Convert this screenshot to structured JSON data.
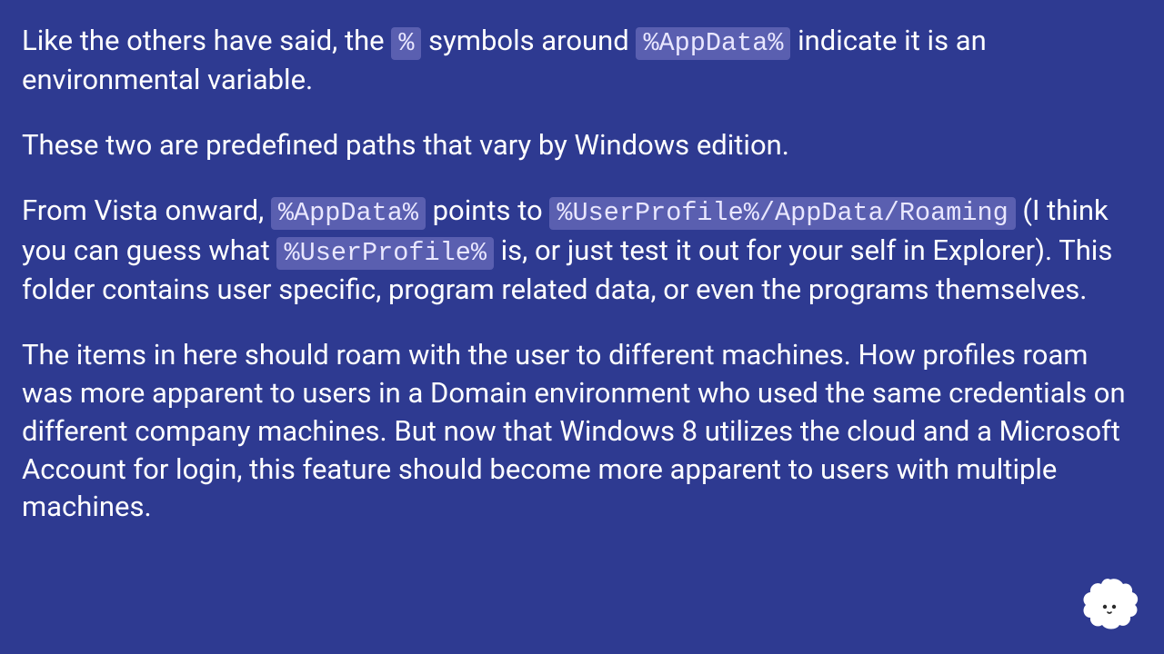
{
  "paragraphs": {
    "p1": {
      "s1": "Like the others have said, the ",
      "c1": "%",
      "s2": " symbols around ",
      "c2": "%AppData%",
      "s3": " indicate it is an environmental variable."
    },
    "p2": "These two are predefined paths that vary by Windows edition.",
    "p3": {
      "s1": "From Vista onward, ",
      "c1": "%AppData%",
      "s2": " points to ",
      "c2": "%UserProfile%/AppData/Roaming",
      "s3": " (I think you can guess what ",
      "c3": "%UserProfile%",
      "s4": " is, or just test it out for your self in Explorer). This folder contains user specific, program related data, or even the programs themselves."
    },
    "p4": "The items in here should roam with the user to different machines. How profiles roam was more apparent to users in a Domain environment who used the same credentials on different company machines. But now that Windows 8 utilizes the cloud and a Microsoft Account for login, this feature should become more apparent to users with multiple machines."
  }
}
